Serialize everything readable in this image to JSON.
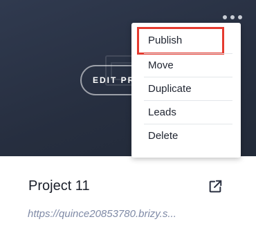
{
  "thumbnail": {
    "edit_button_label": "EDIT PROJECT"
  },
  "more_menu": {
    "icon": "more-horizontal-icon",
    "items": [
      {
        "label": "Publish",
        "highlighted": true
      },
      {
        "label": "Move"
      },
      {
        "label": "Duplicate"
      },
      {
        "label": "Leads"
      },
      {
        "label": "Delete"
      }
    ]
  },
  "project": {
    "title": "Project 11",
    "url": "https://quince20853780.brizy.s...",
    "open_icon": "external-link-icon"
  },
  "colors": {
    "highlight_border": "#e53a2f",
    "url_text": "#7f8aa6",
    "thumbnail_bg": "#2a3244"
  }
}
